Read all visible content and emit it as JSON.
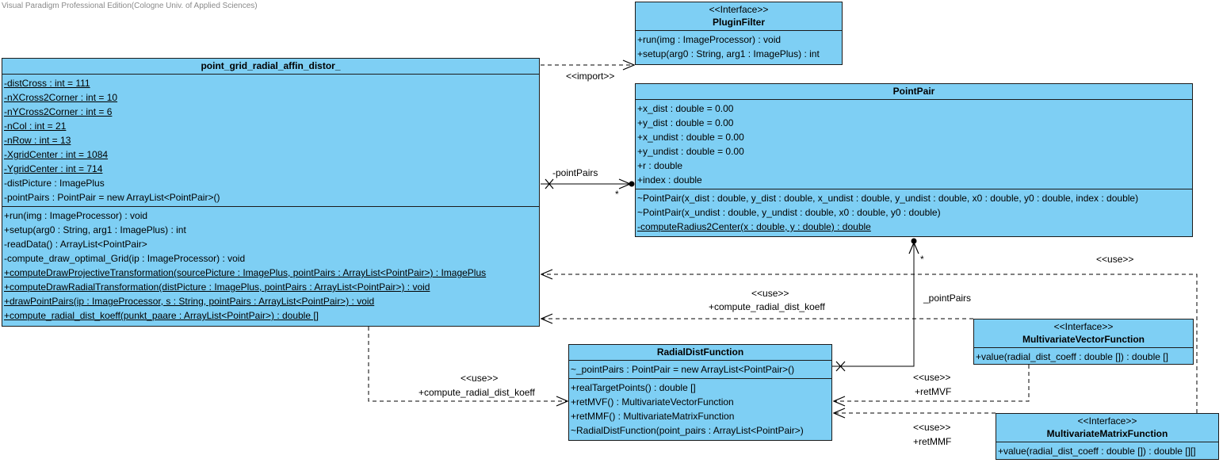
{
  "watermark": "Visual Paradigm Professional Edition(Cologne Univ. of Applied Sciences)",
  "classes": {
    "main": {
      "name": "point_grid_radial_affin_distor_",
      "attributes": [
        {
          "text": "-distCross : int = 111",
          "static": true
        },
        {
          "text": "-nXCross2Corner : int = 10",
          "static": true
        },
        {
          "text": "-nYCross2Corner : int = 6",
          "static": true
        },
        {
          "text": "-nCol : int = 21",
          "static": true
        },
        {
          "text": "-nRow : int = 13",
          "static": true
        },
        {
          "text": "-XgridCenter : int = 1084",
          "static": true
        },
        {
          "text": "-YgridCenter : int = 714",
          "static": true
        },
        {
          "text": "-distPicture : ImagePlus",
          "static": false
        },
        {
          "text": "-pointPairs : PointPair = new ArrayList<PointPair>()",
          "static": false
        }
      ],
      "operations": [
        {
          "text": "+run(img : ImageProcessor) : void",
          "static": false
        },
        {
          "text": "+setup(arg0 : String, arg1 : ImagePlus) : int",
          "static": false
        },
        {
          "text": "-readData() : ArrayList<PointPair>",
          "static": false
        },
        {
          "text": "-compute_draw_optimal_Grid(ip : ImageProcessor) : void",
          "static": false
        },
        {
          "text": "+computeDrawProjectiveTransformation(sourcePicture : ImagePlus, pointPairs : ArrayList<PointPair>) : ImagePlus",
          "static": true
        },
        {
          "text": "+computeDrawRadialTransformation(distPicture : ImagePlus, pointPairs : ArrayList<PointPair>) : void",
          "static": true
        },
        {
          "text": "+drawPointPairs(ip : ImageProcessor, s : String, pointPairs : ArrayList<PointPair>) : void",
          "static": true
        },
        {
          "text": "+compute_radial_dist_koeff(punkt_paare : ArrayList<PointPair>) : double []",
          "static": true
        }
      ]
    },
    "plugin_filter": {
      "stereotype": "<<Interface>>",
      "name": "PluginFilter",
      "operations": [
        {
          "text": "+run(img : ImageProcessor) : void",
          "static": false
        },
        {
          "text": "+setup(arg0 : String, arg1 : ImagePlus) : int",
          "static": false
        }
      ]
    },
    "point_pair": {
      "name": "PointPair",
      "attributes": [
        {
          "text": "+x_dist : double = 0.00",
          "static": false
        },
        {
          "text": "+y_dist : double = 0.00",
          "static": false
        },
        {
          "text": "+x_undist : double = 0.00",
          "static": false
        },
        {
          "text": "+y_undist : double = 0.00",
          "static": false
        },
        {
          "text": "+r : double",
          "static": false
        },
        {
          "text": "+index : double",
          "static": false
        }
      ],
      "operations": [
        {
          "text": "~PointPair(x_dist : double, y_dist : double, x_undist : double, y_undist : double, x0 : double, y0 : double, index : double)",
          "static": false
        },
        {
          "text": "~PointPair(x_undist : double, y_undist : double, x0 : double, y0 : double)",
          "static": false
        },
        {
          "text": "-computeRadius2Center(x : double, y : double) : double",
          "static": true
        }
      ]
    },
    "radial_dist_function": {
      "name": "RadialDistFunction",
      "attributes": [
        {
          "text": "~_pointPairs : PointPair = new ArrayList<PointPair>()",
          "static": false
        }
      ],
      "operations": [
        {
          "text": "+realTargetPoints() : double []",
          "static": false
        },
        {
          "text": "+retMVF() : MultivariateVectorFunction",
          "static": false
        },
        {
          "text": "+retMMF() : MultivariateMatrixFunction",
          "static": false
        },
        {
          "text": "~RadialDistFunction(point_pairs : ArrayList<PointPair>)",
          "static": false
        }
      ]
    },
    "mvf": {
      "stereotype": "<<Interface>>",
      "name": "MultivariateVectorFunction",
      "operations": [
        {
          "text": "+value(radial_dist_coeff : double []) : double []",
          "static": false
        }
      ]
    },
    "mmf": {
      "stereotype": "<<Interface>>",
      "name": "MultivariateMatrixFunction",
      "operations": [
        {
          "text": "+value(radial_dist_coeff : double []) : double [][]",
          "static": false
        }
      ]
    }
  },
  "labels": {
    "import": "<<import>>",
    "point_pairs_role": "-pointPairs",
    "point_pairs_mult": "*",
    "underscore_point_pairs_role": "_pointPairs",
    "underscore_point_pairs_mult": "*",
    "use_right": "<<use>>",
    "use_koeff_stereo": "<<use>>",
    "use_koeff_name": "+compute_radial_dist_koeff",
    "use_koeff2_stereo": "<<use>>",
    "use_koeff2_name": "+compute_radial_dist_koeff",
    "use_mvf_stereo": "<<use>>",
    "use_mvf_name": "+retMVF",
    "use_mmf_stereo": "<<use>>",
    "use_mmf_name": "+retMMF"
  }
}
